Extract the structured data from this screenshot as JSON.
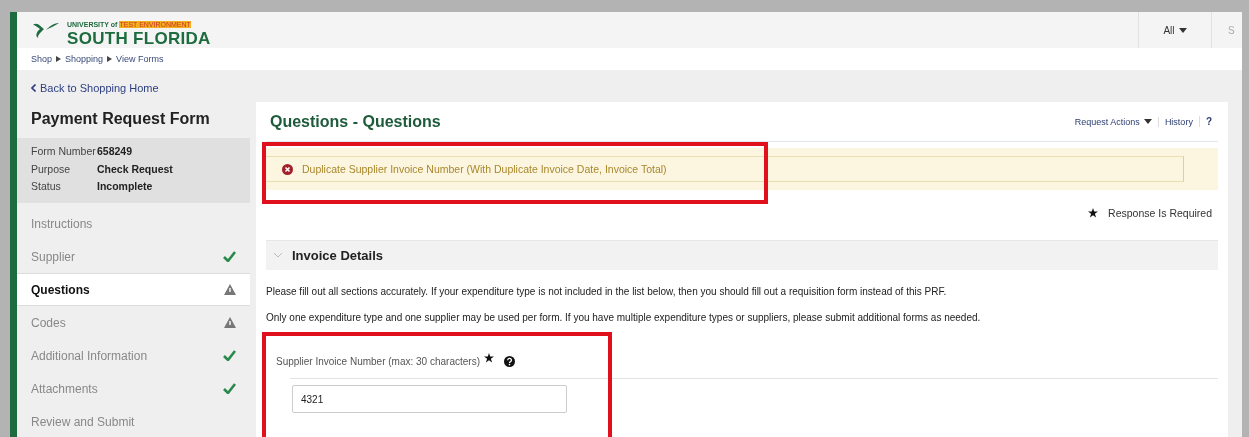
{
  "header": {
    "logo": {
      "overline": "UNIVERSITY of",
      "badge": "TEST ENVIRONMENT",
      "name": "SOUTH FLORIDA"
    },
    "scope": "All",
    "cut_text": "S"
  },
  "breadcrumb": [
    "Shop",
    "Shopping",
    "View Forms"
  ],
  "back_link": "Back to Shopping Home",
  "sidebar": {
    "title": "Payment Request Form",
    "info": [
      {
        "label": "Form Number",
        "value": "658249"
      },
      {
        "label": "Purpose",
        "value": "Check Request"
      },
      {
        "label": "Status",
        "value": "Incomplete"
      }
    ],
    "items": [
      {
        "label": "Instructions",
        "kind": "plain",
        "selected": false
      },
      {
        "label": "Supplier",
        "kind": "done",
        "selected": false
      },
      {
        "label": "Questions",
        "kind": "warning",
        "selected": true
      },
      {
        "label": "Codes",
        "kind": "warning",
        "selected": false
      },
      {
        "label": "Additional Information",
        "kind": "done",
        "selected": false
      },
      {
        "label": "Attachments",
        "kind": "done",
        "selected": false
      },
      {
        "label": "Review and Submit",
        "kind": "plain",
        "selected": false
      }
    ]
  },
  "main": {
    "title": "Questions - Questions",
    "actions": [
      "Request Actions",
      "History",
      "?"
    ],
    "error": "Duplicate Supplier Invoice Number (With Duplicate Invoice Date, Invoice Total)",
    "required_note": "Response Is Required",
    "section": {
      "title": "Invoice Details",
      "expanded": true,
      "paragraphs": [
        "Please fill out all sections accurately. If your expenditure type is not included in the list below, then you should fill out a requisition form instead of this PRF.",
        "Only one expenditure type and one supplier may be used per form. If you have multiple expenditure types or suppliers, please submit additional forms as needed."
      ],
      "field": {
        "label": "Supplier Invoice Number (max: 30 characters)",
        "required": true,
        "value": "4321"
      }
    }
  }
}
